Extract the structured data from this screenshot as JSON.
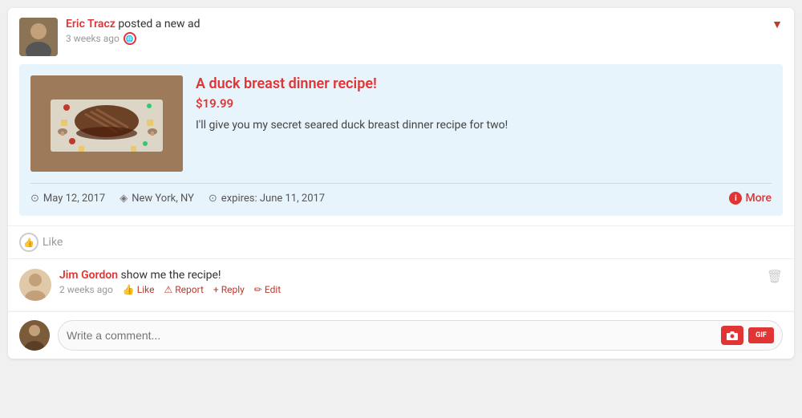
{
  "post": {
    "author": "Eric Tracz",
    "action": " posted a new ad",
    "time": "3 weeks ago",
    "dropdown_label": "▼"
  },
  "ad": {
    "title": "A duck breast dinner recipe!",
    "price": "$19.99",
    "description": "I'll give you my secret seared duck breast dinner recipe for two!",
    "date": "May 12, 2017",
    "location": "New York, NY",
    "expires": "expires: June 11, 2017",
    "more_label": "More"
  },
  "like": {
    "label": "Like"
  },
  "comment": {
    "author": "Jim Gordon",
    "text": " show me the recipe!",
    "time": "2 weeks ago",
    "actions": {
      "like": "Like",
      "report": "Report",
      "reply": "Reply",
      "edit": "Edit"
    }
  },
  "comment_input": {
    "placeholder": "Write a comment...",
    "camera_label": "📷",
    "gif_label": "GIF"
  }
}
